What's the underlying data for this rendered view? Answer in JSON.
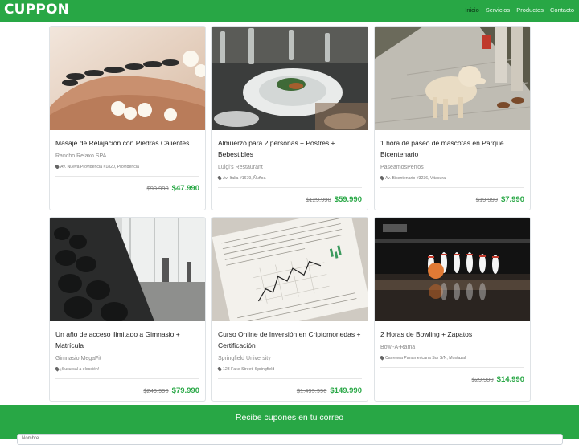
{
  "app": {
    "brand": "CUPPON"
  },
  "nav": {
    "items": [
      "Inicio",
      "Servicios",
      "Productos",
      "Contacto"
    ]
  },
  "cards": [
    {
      "title": "Masaje de Relajación con Piedras Calientes",
      "company": "Rancho Relaxo SPA",
      "address": "Av. Nueva Providencia #1820, Providencia",
      "old_price": "$99.990",
      "new_price": "$47.990",
      "image": "hot-stone-massage"
    },
    {
      "title": "Almuerzo para 2 personas + Postres + Bebestibles",
      "company": "Luigi's Restaurant",
      "address": "Av. Italia #1679, Ñuñoa",
      "old_price": "$129.990",
      "new_price": "$59.990",
      "image": "restaurant-dinner"
    },
    {
      "title": "1 hora de paseo de mascotas en Parque Bicentenario",
      "company": "PaseamosPerros",
      "address": "Av. Bicentenario #3236, Vitacura",
      "old_price": "$19.990",
      "new_price": "$7.990",
      "image": "dog-walk"
    },
    {
      "title": "Un año de acceso ilimitado a Gimnasio + Matrícula",
      "company": "Gimnasio MegaFit",
      "address": "¡Sucursal a elección!",
      "old_price": "$249.990",
      "new_price": "$79.990",
      "image": "gym-dumbbells"
    },
    {
      "title": "Curso Online de Inversión en Criptomonedas + Certificación",
      "company": "Springfield University",
      "address": "123 Fake Street, Springfield",
      "old_price": "$1.499.990",
      "new_price": "$149.990",
      "image": "stock-newspaper"
    },
    {
      "title": "2 Horas de Bowling + Zapatos",
      "company": "Bowl-A-Rama",
      "address": "Carretera Panamericana Sur S/N, Mostazal",
      "old_price": "$29.990",
      "new_price": "$14.990",
      "image": "bowling-pins"
    }
  ],
  "footer": {
    "title": "Recibe cupones en tu correo",
    "input_placeholder": "Nombre"
  },
  "colors": {
    "brand_green": "#28a745",
    "price_green": "#28a745"
  }
}
